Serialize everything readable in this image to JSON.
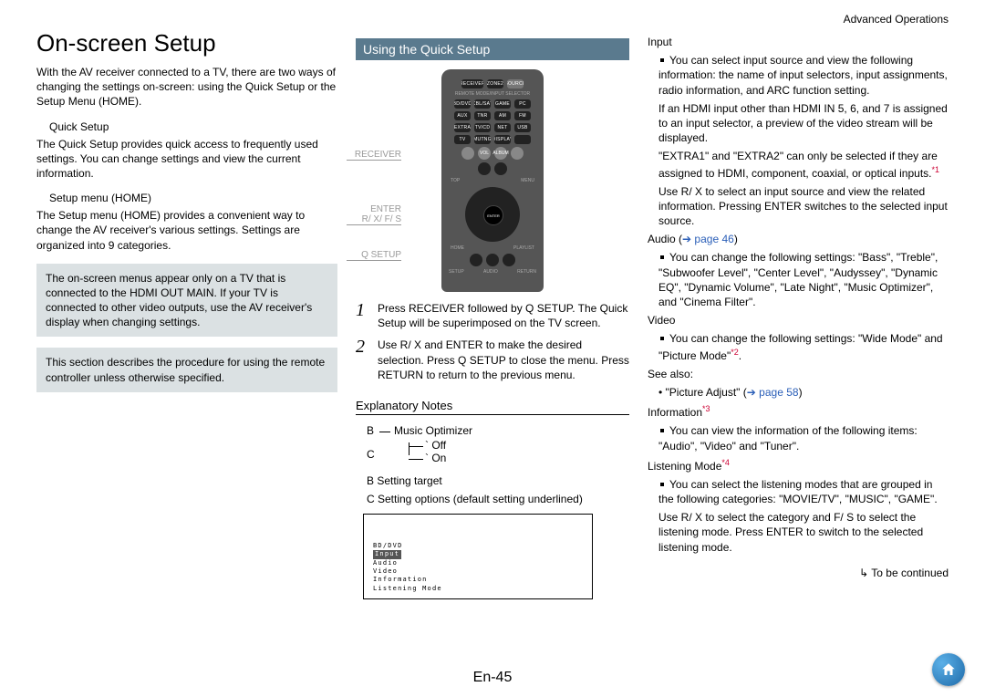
{
  "header": {
    "section": "Advanced Operations"
  },
  "col1": {
    "title": "On-screen Setup",
    "intro": "With the AV receiver connected to a TV, there are two ways of changing the settings on-screen: using the Quick Setup or the Setup Menu (HOME).",
    "qs_head": "Quick Setup",
    "qs_body": "The Quick Setup provides quick access to frequently used settings. You can change settings and view the current information.",
    "sm_head": "Setup menu (HOME)",
    "sm_body": "The Setup menu (HOME) provides a convenient way to change the AV receiver's various settings. Settings are organized into 9 categories.",
    "note1": "The on-screen menus appear only on a TV that is connected to the HDMI OUT MAIN. If your TV is connected to other video outputs, use the AV receiver's display when changing settings.",
    "note2": "This section describes the procedure for using the remote controller unless otherwise specified."
  },
  "col2": {
    "banner": "Using the Quick Setup",
    "remote_labels": {
      "receiver": "RECEIVER",
      "enter": "ENTER\nR/ X/ F/ S",
      "qsetup": "Q SETUP"
    },
    "step1": "Press RECEIVER followed by Q SETUP. The Quick Setup will be superimposed on the TV screen.",
    "step2": "Use R/ X and ENTER to make the desired selection. Press Q SETUP to close the menu. Press RETURN to return to the previous menu.",
    "explain_title": "Explanatory Notes",
    "line_b": "Music Optimizer",
    "opt_off": "` Off",
    "opt_on": "` On",
    "legend_b": "B Setting target",
    "legend_c": "C Setting options (default setting underlined)",
    "osd": {
      "l1": "BD/DVD",
      "l2": "Input",
      "l3": "Audio",
      "l4": "Video",
      "l5": "Information",
      "l6": "Listening Mode"
    }
  },
  "col3": {
    "input_head": "Input",
    "input_p1": "You can select input source and view the following information: the name of input selectors, input assignments, radio information, and ARC function setting.",
    "input_p2": "If an HDMI input other than HDMI IN 5, 6, and 7 is assigned to an input selector, a preview of the video stream will be displayed.",
    "input_p3": "\"EXTRA1\" and \"EXTRA2\" can only be selected if they are assigned to HDMI, component, coaxial, or optical inputs.",
    "input_p4": "Use R/ X to select an input source and view the related information. Pressing ENTER switches to the selected input source.",
    "audio_head": "Audio (",
    "audio_link": " page 46",
    "audio_close": ")",
    "audio_p1": "You can change the following settings: \"Bass\", \"Treble\", \"Subwoofer Level\", \"Center Level\", \"Audyssey\", \"Dynamic EQ\", \"Dynamic Volume\", \"Late Night\", \"Music Optimizer\", and \"Cinema Filter\".",
    "video_head": "Video",
    "video_p1": "You can change the following settings: \"Wide Mode\" and \"Picture Mode\"",
    "seealso": "See also:",
    "pic_adj": "\"Picture Adjust\" (",
    "pic_link": " page 58",
    "pic_close": ")",
    "info_head": "Information",
    "info_p1": "You can view the information of the following items: \"Audio\", \"Video\" and \"Tuner\".",
    "lm_head": "Listening Mode",
    "lm_p1": "You can select the listening modes that are grouped in the following categories: \"MOVIE/TV\", \"MUSIC\", \"GAME\".",
    "lm_p2": "Use R/ X to select the category and F/ S to select the listening mode. Press ENTER to switch to the selected listening mode.",
    "cont": "↳ To be continued"
  },
  "footer": {
    "page": "En-45"
  },
  "sup": {
    "s1": "*1",
    "s2": "*2",
    "s3": "*3",
    "s4": "*4"
  }
}
